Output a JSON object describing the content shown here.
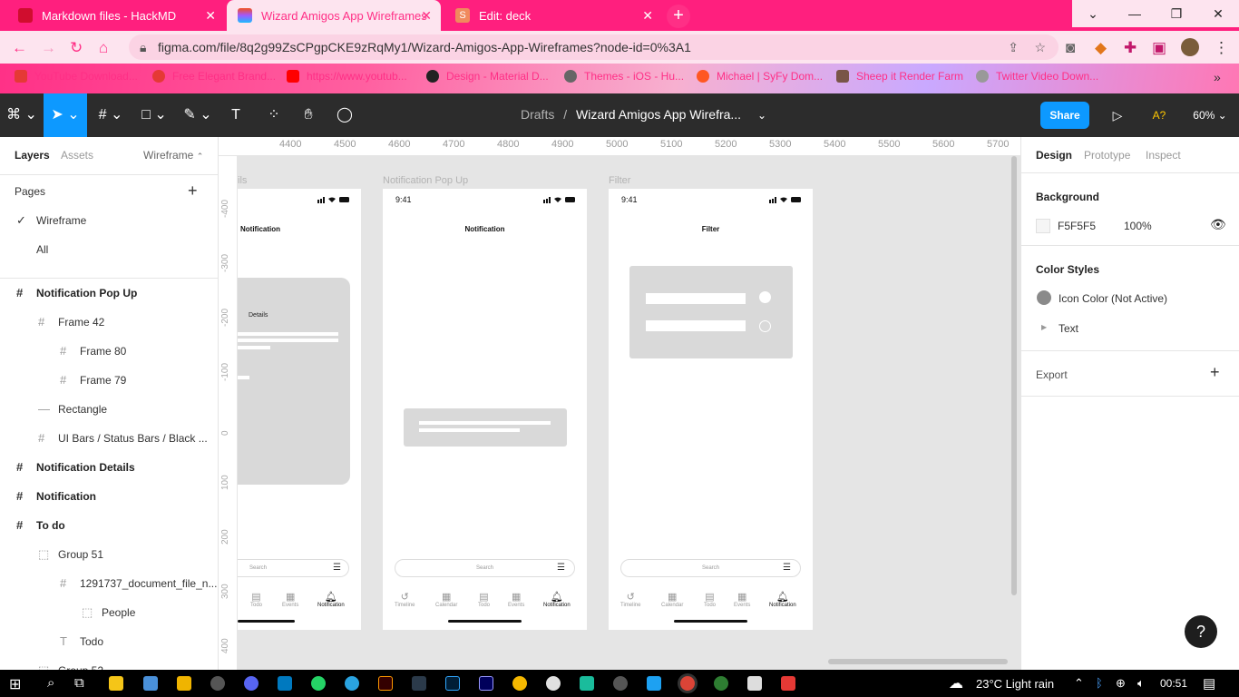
{
  "browser": {
    "tabs": [
      {
        "title": "Markdown files - HackMD",
        "color": "#d00d2e"
      },
      {
        "title": "Wizard Amigos App Wireframes",
        "color": "#a259ff"
      },
      {
        "title": "Edit: deck",
        "color": "#f08a5d",
        "favicon_letter": "S"
      }
    ],
    "new_tab": "+",
    "url": "figma.com/file/8q2g99ZsCPgpCKE9zRqMy1/Wizard-Amigos-App-Wireframes?node-id=0%3A1",
    "bookmarks": [
      "YouTube Download...",
      "Free Elegant Brand...",
      "https://www.youtub...",
      "Design - Material D...",
      "Themes - iOS - Hu...",
      "Michael | SyFy Dom...",
      "Sheep it Render Farm",
      "Twitter Video Down..."
    ],
    "bookmarks_more": "»"
  },
  "toolbar": {
    "crumb_parent": "Drafts",
    "crumb_sep": "/",
    "file_name": "Wizard Amigos App Wirefra...",
    "share_label": "Share",
    "user_badge": "A?",
    "zoom": "60%"
  },
  "left_panel": {
    "tabs": [
      "Layers",
      "Assets"
    ],
    "page_dropdown": "Wireframe",
    "pages_title": "Pages",
    "add": "+",
    "pages": [
      {
        "label": "Wireframe",
        "checked": true
      },
      {
        "label": "All",
        "checked": false
      }
    ],
    "layers": [
      {
        "label": "Notification Pop Up",
        "icon": "#",
        "bold": true,
        "indent": 0
      },
      {
        "label": "Frame 42",
        "icon": "#",
        "bold": false,
        "indent": 1
      },
      {
        "label": "Frame 80",
        "icon": "#",
        "bold": false,
        "indent": 2
      },
      {
        "label": "Frame 79",
        "icon": "#",
        "bold": false,
        "indent": 2
      },
      {
        "label": "Rectangle",
        "icon": "—",
        "bold": false,
        "indent": 1
      },
      {
        "label": "UI Bars / Status Bars / Black ...",
        "icon": "#",
        "bold": false,
        "indent": 1
      },
      {
        "label": "Notification Details",
        "icon": "#",
        "bold": true,
        "indent": 0
      },
      {
        "label": "Notification",
        "icon": "#",
        "bold": true,
        "indent": 0
      },
      {
        "label": "To do",
        "icon": "#",
        "bold": true,
        "indent": 0
      },
      {
        "label": "Group 51",
        "icon": "⬚",
        "bold": false,
        "indent": 1
      },
      {
        "label": "1291737_document_file_n...",
        "icon": "#",
        "bold": false,
        "indent": 2
      },
      {
        "label": "People",
        "icon": "⬚",
        "bold": false,
        "indent": 3
      },
      {
        "label": "Todo",
        "icon": "T",
        "bold": false,
        "indent": 2
      },
      {
        "label": "Group 52",
        "icon": "⬚",
        "bold": false,
        "indent": 1
      }
    ]
  },
  "canvas": {
    "ruler_top": [
      "4400",
      "4500",
      "4600",
      "4700",
      "4800",
      "4900",
      "5000",
      "5100",
      "5200",
      "5300",
      "5400",
      "5500",
      "5600",
      "5700"
    ],
    "ruler_left": [
      "-400",
      "-300",
      "-200",
      "-100",
      "0",
      "100",
      "200",
      "300",
      "400"
    ],
    "frames": [
      {
        "label": "ils",
        "title": "Notification",
        "detail": "Details"
      },
      {
        "label": "Notification Pop Up",
        "time": "9:41",
        "title": "Notification"
      },
      {
        "label": "Filter",
        "time": "9:41",
        "title": "Filter"
      }
    ],
    "search_placeholder": "Search",
    "tab_labels": [
      "Timeline",
      "Calendar",
      "Todo",
      "Events",
      "Notification"
    ]
  },
  "right_panel": {
    "tabs": [
      "Design",
      "Prototype",
      "Inspect"
    ],
    "background_title": "Background",
    "background_hex": "F5F5F5",
    "background_opacity": "100%",
    "color_styles_title": "Color Styles",
    "color_style_name": "Icon Color (Not Active)",
    "color_style_swatch": "#8a8a8a",
    "text_group": "Text",
    "export_title": "Export",
    "export_add": "+"
  },
  "help_label": "?",
  "taskbar": {
    "weather": "23°C  Light rain",
    "time": "00:51"
  }
}
